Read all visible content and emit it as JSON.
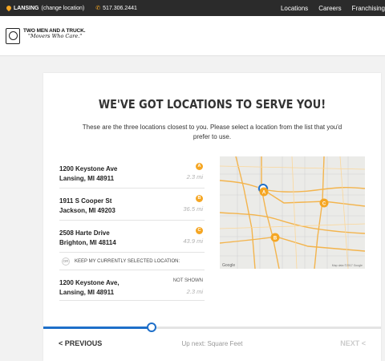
{
  "topbar": {
    "city": "LANSING",
    "change_link": "(change location)",
    "phone": "517.306.2441",
    "nav": [
      "Locations",
      "Careers",
      "Franchising"
    ]
  },
  "logo": {
    "name": "TWO MEN AND A TRUCK.",
    "tagline": "\"Movers Who Care.\""
  },
  "page": {
    "title": "WE'VE GOT LOCATIONS TO SERVE YOU!",
    "subtitle": "These are the three locations closest to you. Please select a location from the list that you'd prefer to use."
  },
  "locations": [
    {
      "street": "1200 Keystone Ave",
      "city": "Lansing, MI 48911",
      "marker": "A",
      "distance": "2.3 mi"
    },
    {
      "street": "1911 S Cooper St",
      "city": "Jackson, MI 49203",
      "marker": "B",
      "distance": "36.5 mi"
    },
    {
      "street": "2508 Harte Drive",
      "city": "Brighton, MI 48114",
      "marker": "C",
      "distance": "43.9 mi"
    }
  ],
  "keep": {
    "or_label": "OR",
    "label": "KEEP MY CURRENTLY SELECTED LOCATION:",
    "street": "1200 Keystone Ave,",
    "city": "Lansing, MI 48911",
    "status": "NOT SHOWN",
    "distance": "2.3 mi"
  },
  "map": {
    "markers": [
      "A",
      "B",
      "C"
    ],
    "attribution": "Map data ©2017 Google",
    "brand": "Google"
  },
  "progress": {
    "value": 0.32
  },
  "footer": {
    "prev": "< PREVIOUS",
    "up_next": "Up next: Square Feet",
    "next": "NEXT <"
  },
  "colors": {
    "accent": "#f5a623",
    "progress": "#1e6fc9",
    "topbar": "#2b2b2b"
  }
}
